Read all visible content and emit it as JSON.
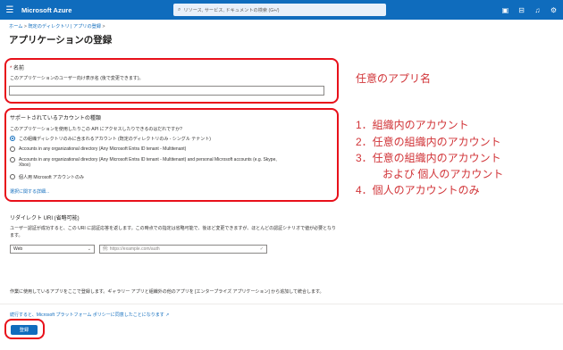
{
  "topbar": {
    "brand": "Microsoft Azure",
    "search_placeholder": "リソース, サービス, ドキュメントの検索 (G+/)",
    "icons": [
      "menu-icon",
      "cloud-shell-icon",
      "directory-filter-icon",
      "notifications-icon",
      "settings-icon"
    ]
  },
  "breadcrumb": {
    "home": "ホーム",
    "sep": " > ",
    "current": "既定のディレクトリ | アプリの登録",
    "trail_sep": " >"
  },
  "page": {
    "title": "アプリケーションの登録",
    "more": "···"
  },
  "name_section": {
    "required_mark": "*",
    "label": "名前",
    "description": "このアプリケーションのユーザー向け表示名 (後で変更できます)。",
    "value": ""
  },
  "account_section": {
    "heading": "サポートされているアカウントの種類",
    "question": "このアプリケーションを使用したりこの API にアクセスしたりできるのはだれですか?",
    "options": [
      {
        "label": "この組織ディレクトリのみに含まれるアカウント (既定のディレクトリのみ - シングル テナント)",
        "checked": true
      },
      {
        "label": "Accounts in any organizational directory (Any Microsoft Entra ID tenant - Multitenant)",
        "checked": false
      },
      {
        "label": "Accounts in any organizational directory (Any Microsoft Entra ID tenant - Multitenant) and personal Microsoft accounts (e.g. Skype,",
        "label2": "Xbox)",
        "checked": false
      },
      {
        "label": "個人用 Microsoft アカウントのみ",
        "checked": false
      }
    ],
    "help_link": "選択に関する詳細..."
  },
  "redirect_section": {
    "heading": "リダイレクト URI (省略可能)",
    "description1": "ユーザー認証が成功すると、この URI に認証応答を返します。この時点での指定は省略可能で、後ほど変更できますが、ほとんどの認証シナリオで値が必要となり",
    "description2": "ます。",
    "platform": "Web",
    "uri_placeholder": "例: https://example.com/auth"
  },
  "footer": {
    "note": "作業に使用しているアプリをここで登録します。ギャラリー アプリと組織外の他のアプリを [エンタープライズ アプリケーション] から追加して統合します。",
    "note_link": "[エンタープライズ アプリケーション]",
    "policy": "続行すると、Microsoft プラットフォーム ポリシーに同意したことになります",
    "register_label": "登録"
  },
  "annotations": {
    "app_name": "任意のアプリ名",
    "item1": "1．組織内のアカウント",
    "item2": "2．任意の組織内のアカウント",
    "item3": "3．任意の組織内のアカウント",
    "item3b": "および 個人のアカウント",
    "item4": "4．個人のアカウントのみ"
  }
}
